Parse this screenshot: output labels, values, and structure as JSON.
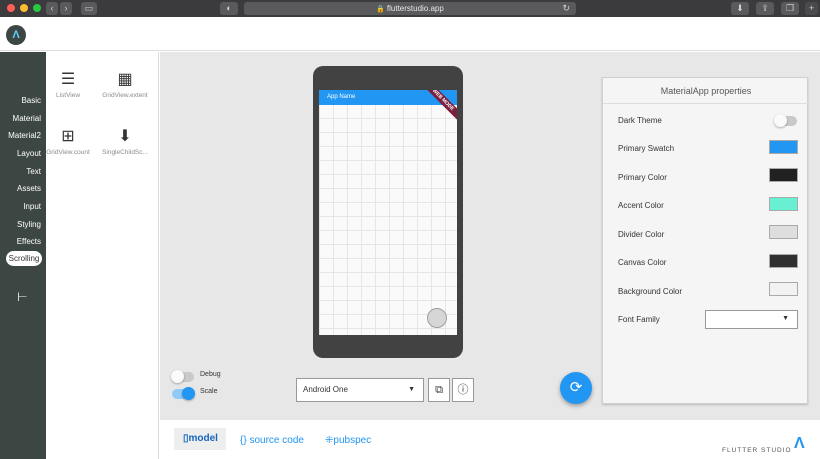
{
  "browser": {
    "url": "flutterstudio.app",
    "icons": [
      "back-icon",
      "forward-icon",
      "sidebar-icon",
      "privacy-icon",
      "lock-icon",
      "reload-icon",
      "download-icon",
      "share-icon",
      "tabs-icon",
      "plus-icon"
    ]
  },
  "app": {
    "logo_glyph": "Λ"
  },
  "leftnav": {
    "items": [
      {
        "label": "Basic"
      },
      {
        "label": "Material"
      },
      {
        "label": "Material2"
      },
      {
        "label": "Layout"
      },
      {
        "label": "Text"
      },
      {
        "label": "Assets"
      },
      {
        "label": "Input"
      },
      {
        "label": "Styling"
      },
      {
        "label": "Effects"
      },
      {
        "label": "Scrolling"
      }
    ],
    "active": "Scrolling"
  },
  "palette": {
    "widgets": [
      {
        "label": "ListView",
        "icon": "list-icon"
      },
      {
        "label": "GridView.extent",
        "icon": "grid-icon"
      },
      {
        "label": "GridView.count",
        "icon": "grid-count-icon"
      },
      {
        "label": "SingleChildSc...",
        "icon": "arrow-down-icon"
      }
    ]
  },
  "preview": {
    "app_name": "App Name",
    "ribbon": "WEB MODE"
  },
  "controls": {
    "debug": {
      "label": "Debug",
      "on": false
    },
    "scale": {
      "label": "Scale",
      "on": true
    },
    "device": "Android One"
  },
  "properties": {
    "title": "MaterialApp properties",
    "rows": [
      {
        "label": "Dark Theme",
        "type": "toggle",
        "on": false
      },
      {
        "label": "Primary Swatch",
        "type": "color",
        "color": "#2196f3"
      },
      {
        "label": "Primary Color",
        "type": "color",
        "color": "#212121"
      },
      {
        "label": "Accent Color",
        "type": "color",
        "color": "#69f0d2"
      },
      {
        "label": "Divider Color",
        "type": "color",
        "color": "#dedede"
      },
      {
        "label": "Canvas Color",
        "type": "color",
        "color": "#303030"
      },
      {
        "label": "Background Color",
        "type": "color",
        "color": "#f2f2f2"
      },
      {
        "label": "Font Family",
        "type": "select",
        "value": ""
      }
    ]
  },
  "bottom_tabs": {
    "model": "model",
    "source": "source code",
    "pubspec": "pubspec",
    "active": "model"
  },
  "brand": "FLUTTER STUDIO"
}
